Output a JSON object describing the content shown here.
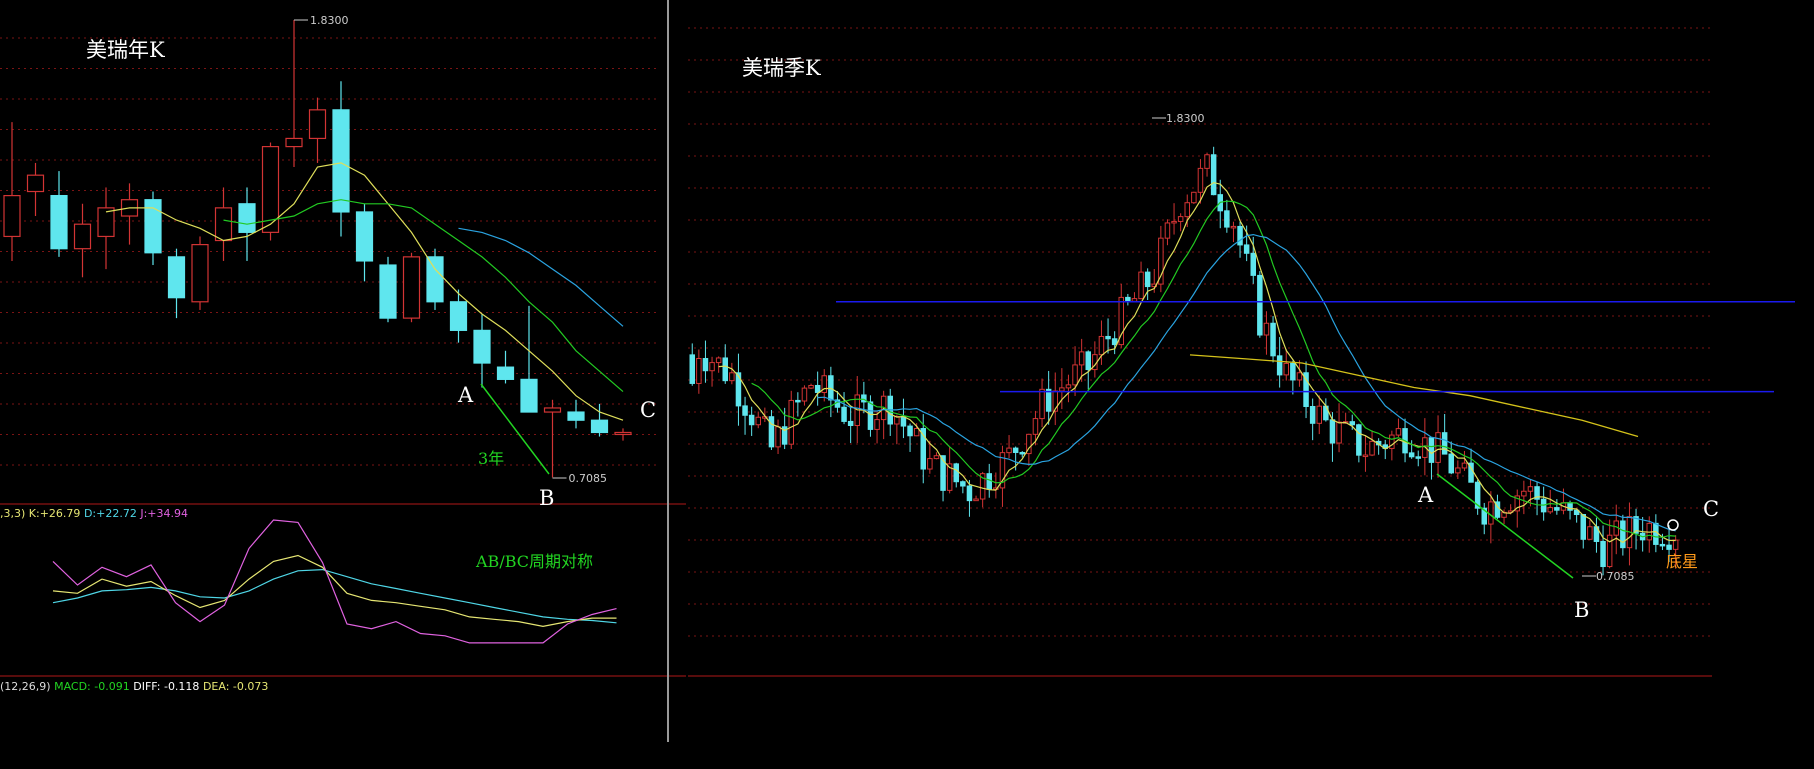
{
  "colors": {
    "background": "#000000",
    "up": "#d23434",
    "down": "#5fe6ee",
    "ma5": "#dede5a",
    "ma10": "#22c922",
    "ma20": "#2aa3e0",
    "ma60": "#d4c21a",
    "hline": "#1a1aee",
    "grid": "#7a1414",
    "ab": "#22d422",
    "k": "#e6e673",
    "d": "#4fd6e6",
    "j": "#e062e0",
    "divider": "#9a9a9a"
  },
  "panels": {
    "annual": {
      "title": "美瑞年K",
      "high_label": "1.8300",
      "low_label": "0.7085",
      "point_a": "A",
      "point_b": "B",
      "point_c": "C",
      "duration_note": "3年",
      "symmetry_note": "AB/BC周期对称",
      "kdj": {
        "prefix": ",3,3)",
        "k_label": "K:",
        "k_value": "+26.79",
        "d_label": "D:",
        "d_value": "+22.72",
        "j_label": "J:",
        "j_value": "+34.94"
      },
      "macd": {
        "prefix": "(12,26,9)",
        "macd_label": "MACD:",
        "macd_value": "-0.091",
        "diff_label": "DIFF:",
        "diff_value": "-0.118",
        "dea_label": "DEA:",
        "dea_value": "-0.073"
      }
    },
    "quarterly": {
      "title": "美瑞季K",
      "high_label": "1.8300",
      "low_label": "0.7085",
      "point_a": "A",
      "point_b": "B",
      "point_c": "C",
      "bottom_star_note": "底星"
    }
  },
  "chart_data": [
    {
      "type": "candlestick",
      "name_ref": "panels.annual.title",
      "price_range": [
        0.6,
        1.9
      ],
      "candles": [
        {
          "o": 1.3,
          "h": 1.58,
          "l": 1.24,
          "c": 1.4
        },
        {
          "o": 1.41,
          "h": 1.48,
          "l": 1.35,
          "c": 1.45
        },
        {
          "o": 1.4,
          "h": 1.46,
          "l": 1.25,
          "c": 1.27
        },
        {
          "o": 1.27,
          "h": 1.38,
          "l": 1.2,
          "c": 1.33
        },
        {
          "o": 1.3,
          "h": 1.42,
          "l": 1.22,
          "c": 1.37
        },
        {
          "o": 1.35,
          "h": 1.43,
          "l": 1.28,
          "c": 1.39
        },
        {
          "o": 1.39,
          "h": 1.41,
          "l": 1.23,
          "c": 1.26
        },
        {
          "o": 1.25,
          "h": 1.27,
          "l": 1.1,
          "c": 1.15
        },
        {
          "o": 1.14,
          "h": 1.3,
          "l": 1.12,
          "c": 1.28
        },
        {
          "o": 1.29,
          "h": 1.42,
          "l": 1.24,
          "c": 1.37
        },
        {
          "o": 1.38,
          "h": 1.42,
          "l": 1.24,
          "c": 1.31
        },
        {
          "o": 1.31,
          "h": 1.53,
          "l": 1.29,
          "c": 1.52
        },
        {
          "o": 1.52,
          "h": 1.83,
          "l": 1.47,
          "c": 1.54
        },
        {
          "o": 1.54,
          "h": 1.64,
          "l": 1.48,
          "c": 1.61
        },
        {
          "o": 1.61,
          "h": 1.68,
          "l": 1.3,
          "c": 1.36
        },
        {
          "o": 1.36,
          "h": 1.38,
          "l": 1.19,
          "c": 1.24
        },
        {
          "o": 1.23,
          "h": 1.25,
          "l": 1.09,
          "c": 1.1
        },
        {
          "o": 1.1,
          "h": 1.26,
          "l": 1.09,
          "c": 1.25
        },
        {
          "o": 1.25,
          "h": 1.27,
          "l": 1.12,
          "c": 1.14
        },
        {
          "o": 1.14,
          "h": 1.17,
          "l": 1.04,
          "c": 1.07
        },
        {
          "o": 1.07,
          "h": 1.11,
          "l": 0.93,
          "c": 0.99
        },
        {
          "o": 0.98,
          "h": 1.02,
          "l": 0.94,
          "c": 0.95
        },
        {
          "o": 0.95,
          "h": 1.13,
          "l": 0.91,
          "c": 0.87
        },
        {
          "o": 0.87,
          "h": 0.9,
          "l": 0.71,
          "c": 0.88
        },
        {
          "o": 0.87,
          "h": 0.9,
          "l": 0.83,
          "c": 0.85
        },
        {
          "o": 0.85,
          "h": 0.89,
          "l": 0.81,
          "c": 0.82
        },
        {
          "o": 0.82,
          "h": 0.83,
          "l": 0.8,
          "c": 0.82
        }
      ],
      "ma": {
        "ma5": [
          null,
          null,
          null,
          null,
          1.36,
          1.37,
          1.37,
          1.34,
          1.32,
          1.29,
          1.3,
          1.33,
          1.38,
          1.47,
          1.48,
          1.45,
          1.38,
          1.31,
          1.22,
          1.16,
          1.11,
          1.07,
          1.02,
          0.97,
          0.91,
          0.87,
          0.85
        ],
        "ma10": [
          null,
          null,
          null,
          null,
          null,
          null,
          null,
          null,
          null,
          1.34,
          1.33,
          1.34,
          1.35,
          1.38,
          1.39,
          1.38,
          1.38,
          1.37,
          1.33,
          1.29,
          1.25,
          1.2,
          1.14,
          1.09,
          1.02,
          0.97,
          0.92
        ],
        "ma20": [
          null,
          null,
          null,
          null,
          null,
          null,
          null,
          null,
          null,
          null,
          null,
          null,
          null,
          null,
          null,
          null,
          null,
          null,
          null,
          1.32,
          1.31,
          1.29,
          1.26,
          1.22,
          1.18,
          1.13,
          1.08
        ]
      },
      "kdj": {
        "k": [
          null,
          null,
          50,
          48,
          60,
          54,
          58,
          46,
          36,
          42,
          60,
          75,
          80,
          70,
          48,
          42,
          40,
          37,
          34,
          28,
          26,
          24,
          20,
          24,
          27,
          27
        ],
        "d": [
          null,
          null,
          40,
          44,
          50,
          51,
          53,
          50,
          45,
          44,
          50,
          60,
          67,
          68,
          62,
          56,
          52,
          48,
          44,
          40,
          36,
          32,
          28,
          26,
          25,
          23
        ],
        "j": [
          null,
          null,
          75,
          55,
          70,
          62,
          72,
          40,
          24,
          38,
          86,
          110,
          108,
          74,
          22,
          18,
          24,
          14,
          12,
          6,
          6,
          6,
          6,
          22,
          30,
          35
        ]
      }
    },
    {
      "type": "candlestick",
      "name_ref": "panels.quarterly.title",
      "price_range": [
        0.6,
        1.9
      ],
      "note": "quarterly K-line, ~100 quarters with MA lines and two horizontal support/resistance lines",
      "hlines": [
        1.38,
        1.16
      ],
      "ma60_points": [
        [
          0,
          1.25
        ],
        [
          1,
          1.24
        ],
        [
          2,
          1.23
        ],
        [
          3,
          1.2
        ],
        [
          4,
          1.17
        ],
        [
          5,
          1.15
        ],
        [
          6,
          1.12
        ],
        [
          7,
          1.09
        ],
        [
          8,
          1.05
        ]
      ]
    }
  ]
}
